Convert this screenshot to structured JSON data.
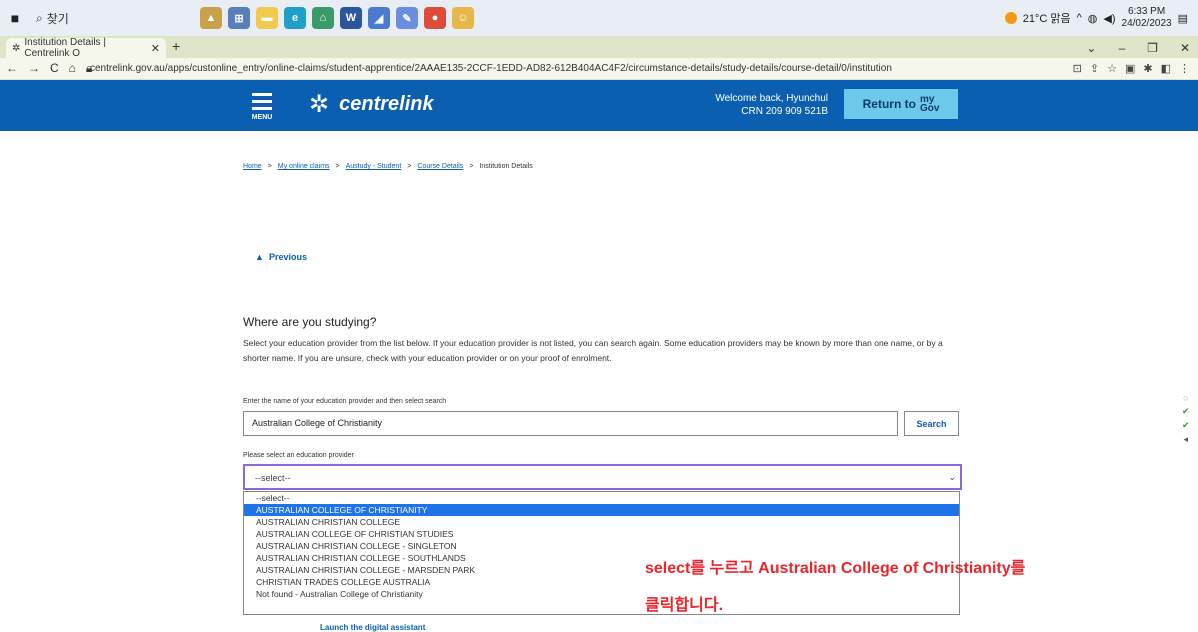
{
  "taskbar": {
    "search_label": "찾기",
    "weather": "21°C 맑음",
    "time": "6:33 PM",
    "date": "24/02/2023",
    "icons": [
      "file-explorer-icon",
      "folder-icon",
      "edge-icon",
      "store-icon",
      "word-icon",
      "app-icon",
      "app-icon-2",
      "chrome-icon",
      "game-icon"
    ]
  },
  "browser": {
    "tab_title": "Institution Details | Centrelink O",
    "url": "centrelink.gov.au/apps/custonline_entry/online-claims/student-apprentice/2AAAE135-2CCF-1EDD-AD82-612B404AC4F2/circumstance-details/study-details/course-detail/0/institution"
  },
  "header": {
    "menu_label": "MENU",
    "brand": "centrelink",
    "welcome": "Welcome back, Hyunchul",
    "crn": "CRN 209 909 521B",
    "return_label": "Return to",
    "mygov_top": "my",
    "mygov_bottom": "Gov"
  },
  "breadcrumb": {
    "items": [
      "Home",
      "My online claims",
      "Austudy - Student",
      "Course Details",
      "Institution Details"
    ]
  },
  "main": {
    "previous": "Previous",
    "heading": "Where are you studying?",
    "description": "Select your education provider from the list below. If your education provider is not listed, you can search again. Some education providers may be known by more than one name, or by a shorter name. If you are unsure, check with your education provider or on your proof of enrolment.",
    "search_label": "Enter the name of your education provider and then select search",
    "search_value": "Australian College of Christianity",
    "search_button": "Search",
    "select_label": "Please select an education provider",
    "select_value": "--select--",
    "options": [
      "--select--",
      "AUSTRALIAN COLLEGE OF CHRISTIANITY",
      "AUSTRALIAN CHRISTIAN COLLEGE",
      "AUSTRALIAN COLLEGE OF CHRISTIAN STUDIES",
      "AUSTRALIAN CHRISTIAN COLLEGE - SINGLETON",
      "AUSTRALIAN CHRISTIAN COLLEGE - SOUTHLANDS",
      "AUSTRALIAN CHRISTIAN COLLEGE - MARSDEN PARK",
      "CHRISTIAN TRADES COLLEGE AUSTRALIA",
      "Not found - Australian College of Christianity"
    ],
    "selected_index": 1,
    "instruction_line1": "select를 누르고 Australian College of Christianity를",
    "instruction_line2": "클릭합니다.",
    "assistant": "Launch the digital assistant"
  },
  "colors": {
    "header": "#0b5fb0",
    "mygov": "#6cc9e8",
    "highlight": "#1e73e8",
    "instruction": "#e8262c"
  }
}
